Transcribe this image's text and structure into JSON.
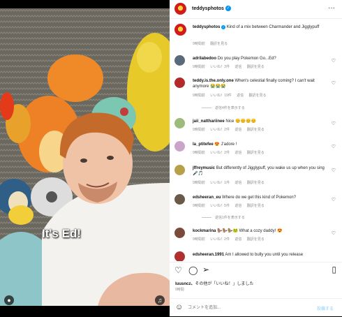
{
  "media": {
    "caption": "It's Ed!",
    "user_icon": "user-icon",
    "sound_icon": "sound-icon"
  },
  "header": {
    "username": "teddysphotos",
    "verified_icon": "verified-badge-icon",
    "more_icon": "more-options-icon"
  },
  "post": {
    "username": "teddysphotos",
    "caption": "Kind of a mix between Charmander and Jigglypuff",
    "time": "9時間前",
    "translate": "翻訳を見る"
  },
  "comments": [
    {
      "username": "adrilabedoo",
      "text": "Do you play Pokemon Go...Ed?",
      "time": "9時間前",
      "likes": "いいね！3件",
      "reply": "返信",
      "translate": "翻訳を見る",
      "avatar": "#5a6a7a"
    },
    {
      "username": "teddy.is.the.only.one",
      "text": "When's celestial finally coming? I can't wait anymore 😭😭😭",
      "time": "9時間前",
      "likes": "いいね！19件",
      "reply": "返信",
      "translate": "翻訳を見る",
      "avatar": "#b32a2a",
      "replies": "返信4件を表示する"
    },
    {
      "username": "jaii_natthariinee",
      "text": "Nice 😊😊😊😊",
      "time": "9時間前",
      "likes": "いいね！2件",
      "reply": "返信",
      "translate": "翻訳を見る",
      "avatar": "#9dbb7a"
    },
    {
      "username": "la_ptitefee",
      "text": "😍 J'adore !",
      "time": "9時間前",
      "likes": "いいね！2件",
      "reply": "返信",
      "translate": "翻訳を見る",
      "avatar": "#c9a6c9"
    },
    {
      "username": "jffreymusic",
      "text": "But differently of Jigglypuff, you wake us up when you sing 🎤🎵",
      "time": "9時間前",
      "likes": "いいね！1件",
      "reply": "返信",
      "translate": "翻訳を見る",
      "avatar": "#b8a04a"
    },
    {
      "username": "edsheeran_eu",
      "text": "Where do we get this kind of Pokemon?",
      "time": "9時間前",
      "likes": "いいね！5件",
      "reply": "返信",
      "translate": "翻訳を見る",
      "avatar": "#6a5a4a",
      "replies": "返信1件を表示する"
    },
    {
      "username": "kockmarina",
      "text": "🦫🦫🦫🐸 What a cozy daddy! 😍",
      "time": "9時間前",
      "likes": "いいね！2件",
      "reply": "返信",
      "translate": "翻訳を見る",
      "avatar": "#7a4a3a"
    },
    {
      "username": "edsheeran.1991",
      "text": "Am I allowed to bully you until you release",
      "avatar": "#b03030"
    }
  ],
  "actions": {
    "like_icon": "heart-icon",
    "comment_icon": "comment-icon",
    "share_icon": "send-icon",
    "save_icon": "bookmark-icon"
  },
  "likes_text": {
    "prefix": "luusncz、",
    "rest": "その他が「いいね！」しました",
    "time": "9時間"
  },
  "footer": {
    "emoji_icon": "emoji-icon",
    "placeholder": "コメントを追加...",
    "post_button": "投稿する"
  },
  "colors": {
    "link_blue": "#0095f6",
    "verified_blue": "#0095f6"
  }
}
